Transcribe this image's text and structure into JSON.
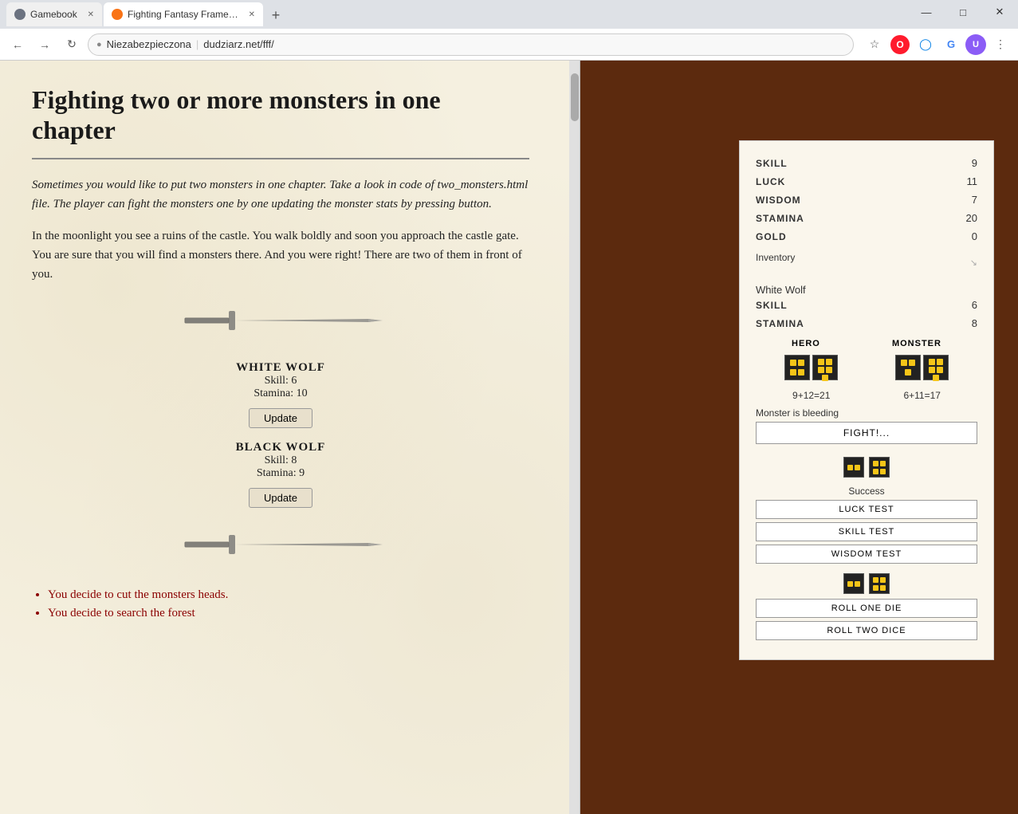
{
  "browser": {
    "tabs": [
      {
        "id": "tab1",
        "label": "Gamebook",
        "icon_color": "gray",
        "active": false
      },
      {
        "id": "tab2",
        "label": "Fighting Fantasy Framework dow",
        "icon_color": "orange",
        "active": true
      }
    ],
    "address": {
      "protocol": "Niezabezpieczona",
      "url": "dudziarz.net/fff/"
    },
    "window_controls": {
      "minimize": "—",
      "maximize": "□",
      "close": "✕"
    }
  },
  "book": {
    "title": "Fighting two or more monsters in one chapter",
    "paragraph1": "Sometimes you would like to put two monsters in one chapter. Take a look in code of two_monsters.html file. The player can fight the monsters one by one updating the monster stats by pressing button.",
    "paragraph2": "In the moonlight you see a ruins of the castle. You walk boldly and soon you approach the castle gate. You are sure that you will find a monsters there. And you were right! There are two of them in front of you.",
    "monster1": {
      "name": "WHITE WOLF",
      "skill_label": "Skill:",
      "skill": "6",
      "stamina_label": "Stamina:",
      "stamina": "10",
      "update_btn": "Update"
    },
    "monster2": {
      "name": "BLACK WOLF",
      "skill_label": "Skill:",
      "skill": "8",
      "stamina_label": "Stamina:",
      "stamina": "9",
      "update_btn": "Update"
    },
    "choices": [
      "You decide to cut the monsters heads.",
      "You decide to search the forest"
    ]
  },
  "stats": {
    "skill_label": "SKILL",
    "skill_value": "9",
    "luck_label": "LUCK",
    "luck_value": "11",
    "wisdom_label": "WISDOM",
    "wisdom_value": "7",
    "stamina_label": "STAMINA",
    "stamina_value": "20",
    "gold_label": "GOLD",
    "gold_value": "0",
    "inventory_label": "Inventory",
    "monster_name": "White Wolf",
    "monster_skill_label": "SKILL",
    "monster_skill_value": "6",
    "monster_stamina_label": "STAMINA",
    "monster_stamina_value": "8",
    "combat": {
      "hero_label": "HERO",
      "monster_label": "MONSTER",
      "hero_score": "9+12=21",
      "monster_score": "6+11=17",
      "status": "Monster is bleeding",
      "fight_btn": "FIGHT!..."
    },
    "luck_test": {
      "result": "Success",
      "luck_btn": "LUCK TEST",
      "skill_btn": "SKILL TEST",
      "wisdom_btn": "WISDOM TEST"
    },
    "roll": {
      "roll_one_btn": "ROLL ONE DIE",
      "roll_two_btn": "ROLL TWO DICE"
    }
  }
}
